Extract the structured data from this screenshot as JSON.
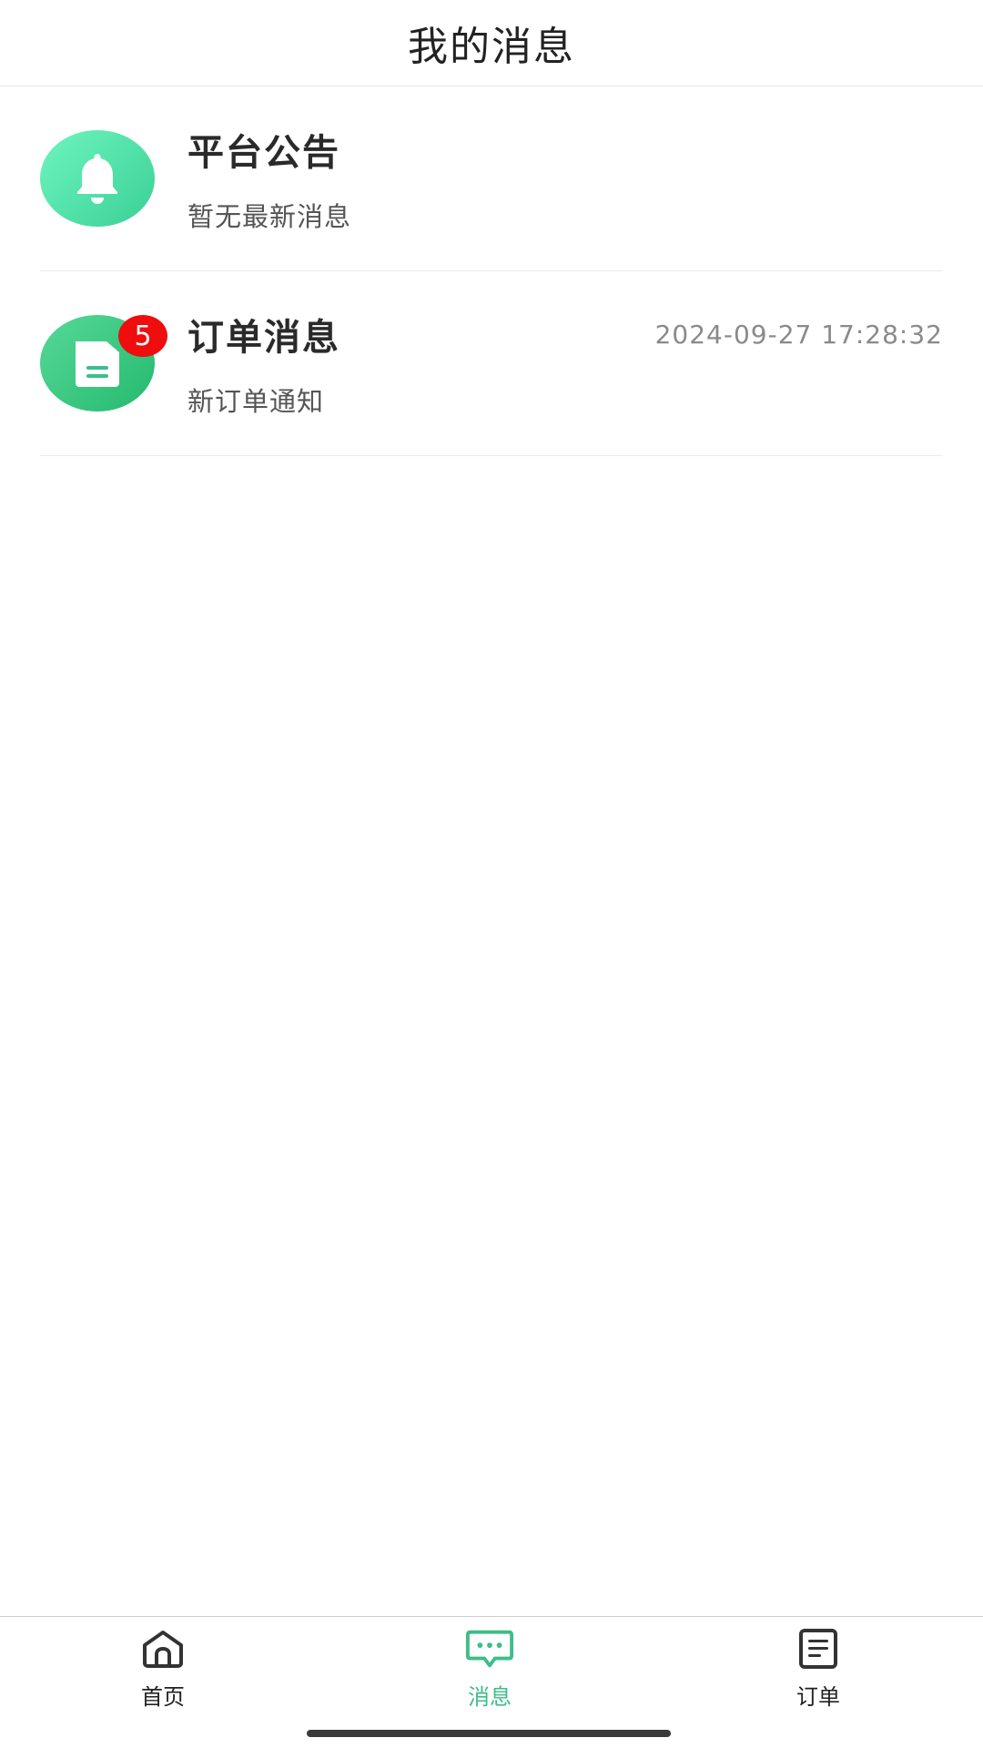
{
  "header": {
    "title": "我的消息"
  },
  "messages": [
    {
      "title": "平台公告",
      "subtitle": "暂无最新消息",
      "time": "",
      "icon": "bell-icon",
      "badge": ""
    },
    {
      "title": "订单消息",
      "subtitle": "新订单通知",
      "time": "2024-09-27 17:28:32",
      "icon": "document-icon",
      "badge": "5"
    }
  ],
  "tabbar": {
    "items": [
      {
        "label": "首页",
        "icon": "home-icon",
        "active": false
      },
      {
        "label": "消息",
        "icon": "chat-icon",
        "active": true
      },
      {
        "label": "订单",
        "icon": "order-list-icon",
        "active": false
      }
    ]
  },
  "colors": {
    "accent": "#3cbd8a",
    "badge": "#f00d0d"
  }
}
